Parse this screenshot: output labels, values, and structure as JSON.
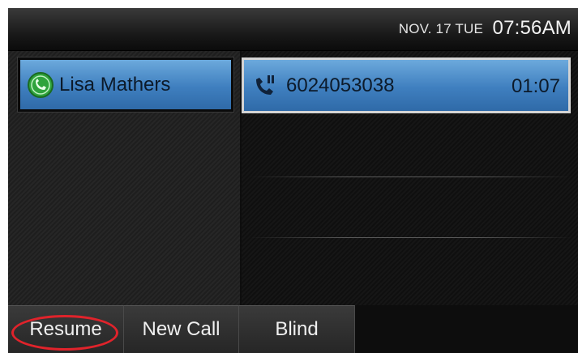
{
  "status_bar": {
    "date": "NOV. 17 TUE",
    "time": "07:56AM"
  },
  "line": {
    "label": "Lisa Mathers",
    "icon": "phone-line-icon"
  },
  "call": {
    "number": "6024053038",
    "duration": "01:07",
    "icon": "phone-hold-icon"
  },
  "softkeys": [
    {
      "label": "Resume"
    },
    {
      "label": "New Call"
    },
    {
      "label": "Blind"
    }
  ],
  "colors": {
    "accent_blue": "#4a8bcb",
    "highlight_red": "#e0232b",
    "line_green": "#39b54a"
  }
}
